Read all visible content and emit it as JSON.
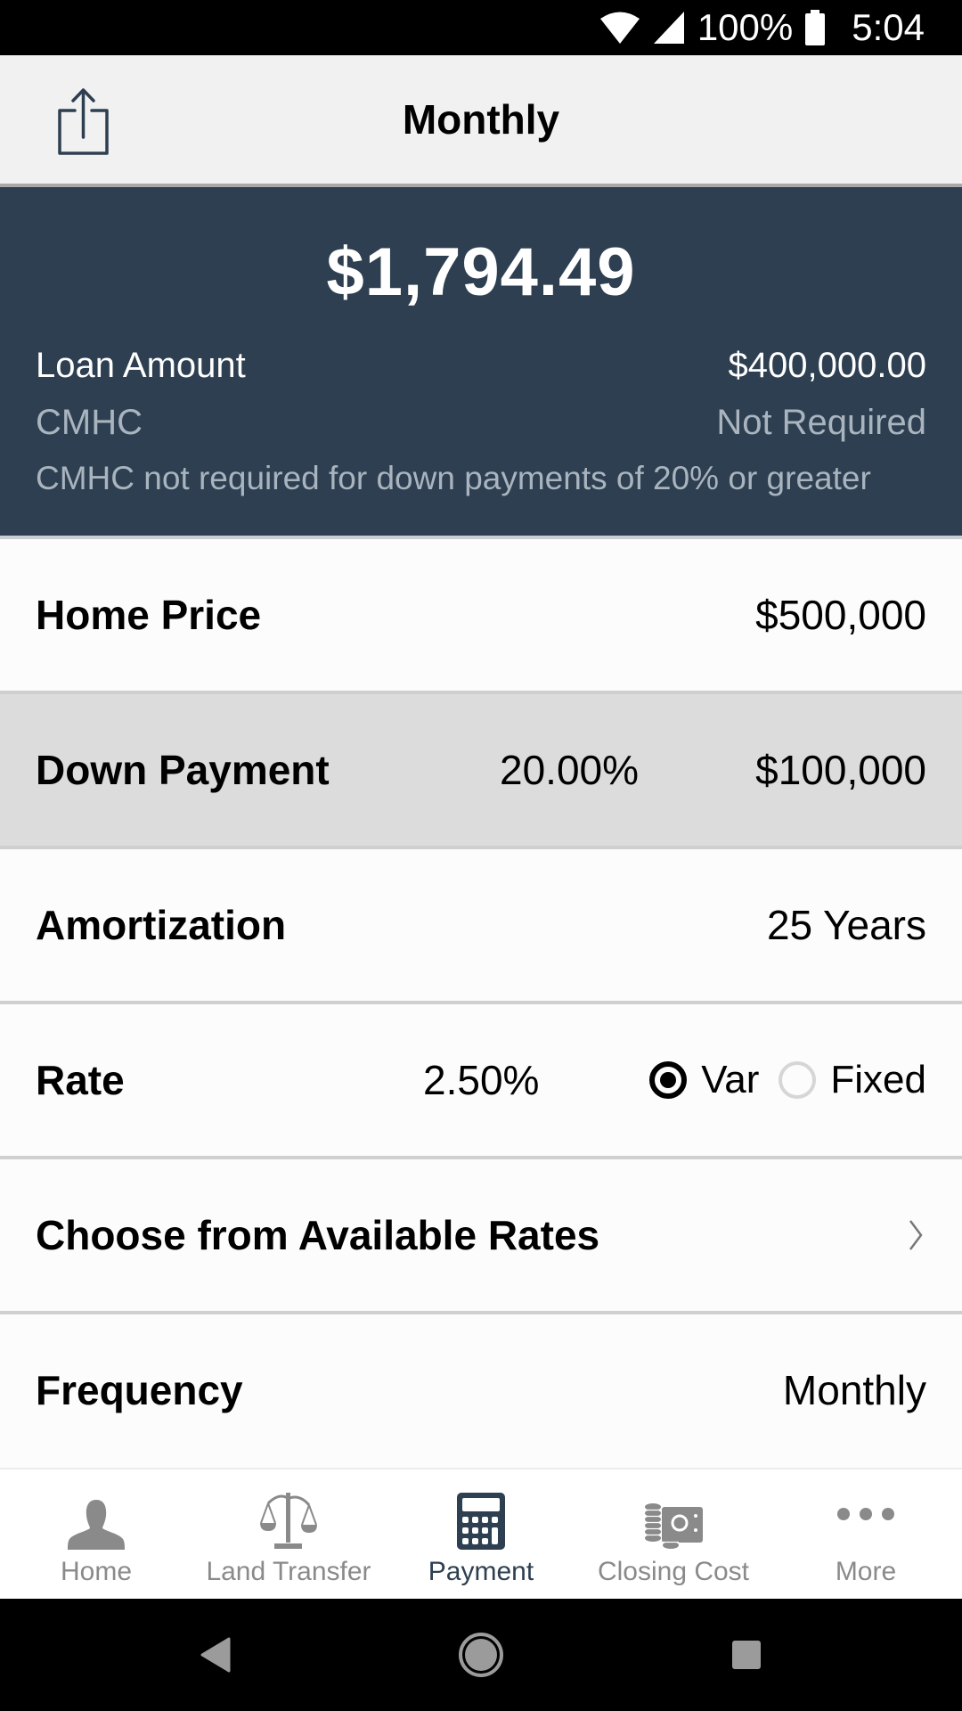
{
  "status_bar": {
    "battery_percent": "100%",
    "time": "5:04",
    "icons": [
      "wifi-icon",
      "cell-signal-icon",
      "battery-icon"
    ]
  },
  "header": {
    "title": "Monthly",
    "share_icon": "share-icon"
  },
  "summary": {
    "payment_amount": "$1,794.49",
    "loan_amount_label": "Loan Amount",
    "loan_amount_value": "$400,000.00",
    "cmhc_label": "CMHC",
    "cmhc_value": "Not Required",
    "cmhc_note": "CMHC not required for down payments of 20% or greater"
  },
  "form": {
    "home_price": {
      "label": "Home Price",
      "value": "$500,000"
    },
    "down_payment": {
      "label": "Down Payment",
      "percent": "20.00%",
      "value": "$100,000"
    },
    "amortization": {
      "label": "Amortization",
      "value": "25 Years"
    },
    "rate": {
      "label": "Rate",
      "value": "2.50%",
      "options": [
        {
          "label": "Var",
          "selected": true
        },
        {
          "label": "Fixed",
          "selected": false
        }
      ]
    },
    "available_rates": {
      "label": "Choose from Available Rates",
      "icon": "chevron-right-icon"
    },
    "frequency": {
      "label": "Frequency",
      "value": "Monthly"
    }
  },
  "bottom_nav": {
    "items": [
      {
        "label": "Home",
        "icon": "person-icon",
        "active": false
      },
      {
        "label": "Land Transfer",
        "icon": "scales-icon",
        "active": false
      },
      {
        "label": "Payment",
        "icon": "calculator-icon",
        "active": true
      },
      {
        "label": "Closing Cost",
        "icon": "money-coins-icon",
        "active": false
      },
      {
        "label": "More",
        "icon": "more-dots-icon",
        "active": false
      }
    ]
  },
  "colors": {
    "summary_bg": "#2d3f50",
    "active_nav": "#2d3f50",
    "inactive_nav": "#8a8a8a",
    "highlight_row": "#dcdcdc"
  }
}
